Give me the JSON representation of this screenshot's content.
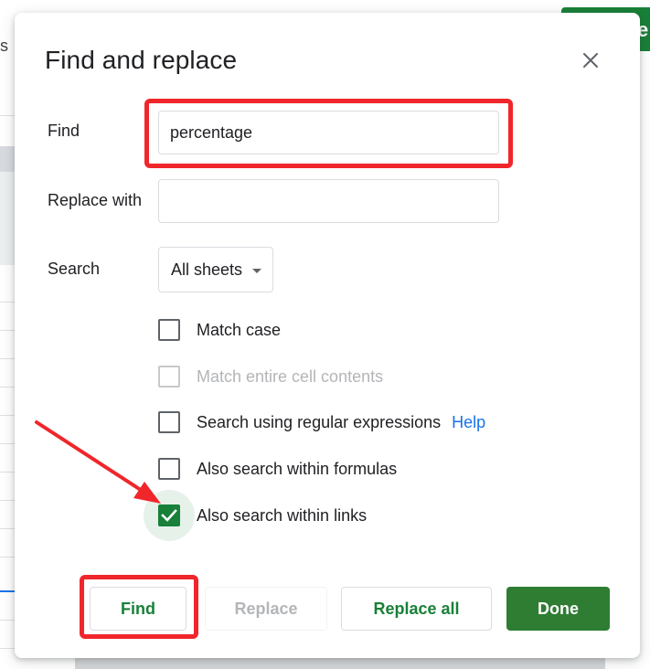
{
  "background": {
    "partial_column_letter": "s",
    "partial_tab_letter": "e"
  },
  "dialog": {
    "title": "Find and replace",
    "close_icon": "close-icon"
  },
  "find": {
    "label": "Find",
    "value": "percentage"
  },
  "replace_with": {
    "label": "Replace with",
    "value": ""
  },
  "search": {
    "label": "Search",
    "selected": "All sheets"
  },
  "options": [
    {
      "label": "Match case",
      "checked": false,
      "disabled": false
    },
    {
      "label": "Match entire cell contents",
      "checked": false,
      "disabled": true
    },
    {
      "label": "Search using regular expressions",
      "checked": false,
      "disabled": false,
      "help_link": "Help"
    },
    {
      "label": "Also search within formulas",
      "checked": false,
      "disabled": false
    },
    {
      "label": "Also search within links",
      "checked": true,
      "disabled": false
    }
  ],
  "buttons": {
    "find": "Find",
    "replace": "Replace",
    "replace_all": "Replace all",
    "done": "Done"
  },
  "colors": {
    "accent_green": "#188038",
    "done_green": "#2e7d32",
    "link_blue": "#1a73e8",
    "annotation_red": "#f0262b"
  }
}
